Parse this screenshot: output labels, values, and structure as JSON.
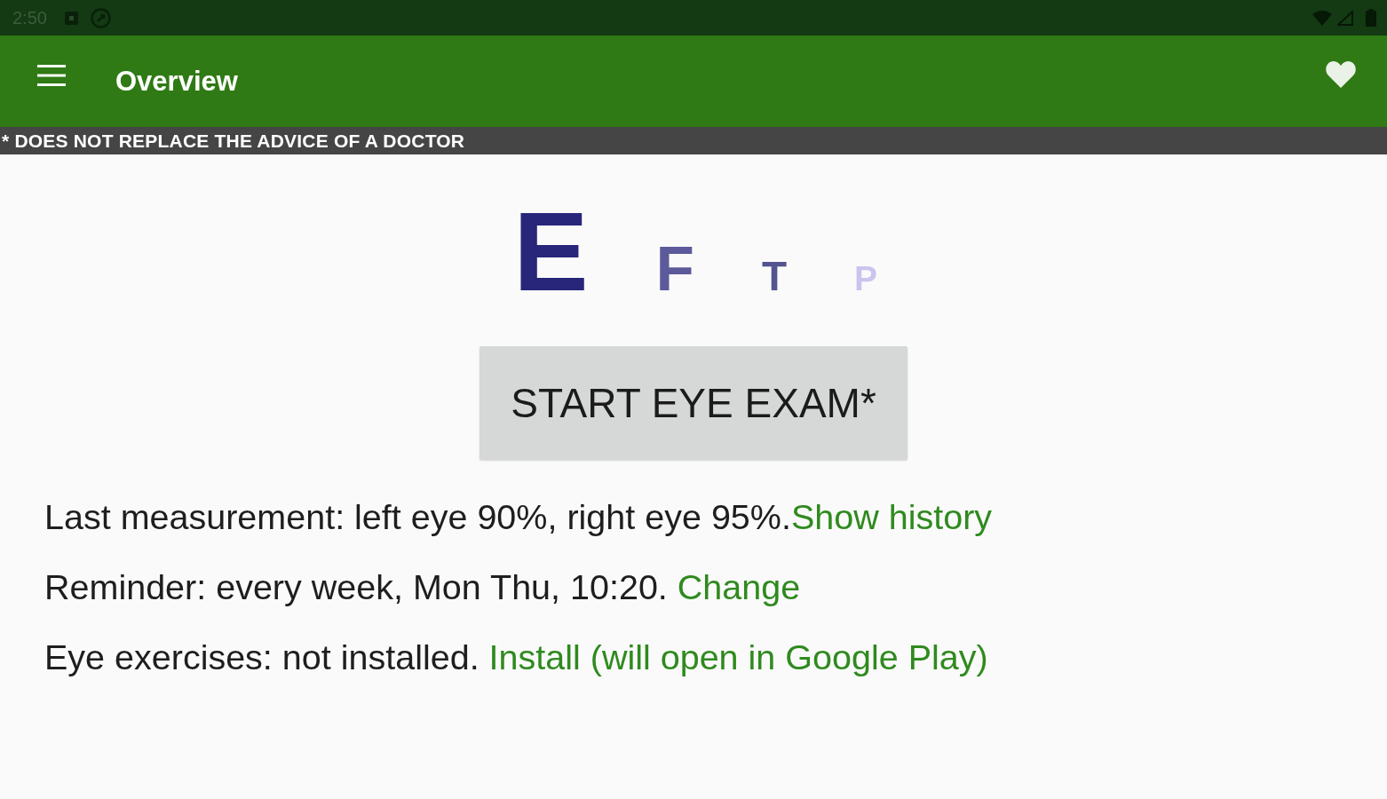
{
  "status_bar": {
    "time": "2:50"
  },
  "app_bar": {
    "title": "Overview"
  },
  "banner": {
    "text": "* DOES NOT REPLACE THE ADVICE OF A DOCTOR"
  },
  "eye_chart": {
    "letters": [
      {
        "char": "E",
        "color": "#28267a"
      },
      {
        "char": "F",
        "color": "#5c5a9a"
      },
      {
        "char": "T",
        "color": "#545490"
      },
      {
        "char": "P",
        "color": "#c9c5ef"
      }
    ]
  },
  "start_button": {
    "label": "START EYE EXAM*"
  },
  "info_lines": [
    {
      "text": "Last measurement: left eye 90%, right eye 95%.",
      "link": "Show history"
    },
    {
      "text": "Reminder: every week, Mon Thu, 10:20. ",
      "link": "Change"
    },
    {
      "text": "Eye exercises: not installed. ",
      "link": "Install (will open in Google Play)"
    }
  ]
}
